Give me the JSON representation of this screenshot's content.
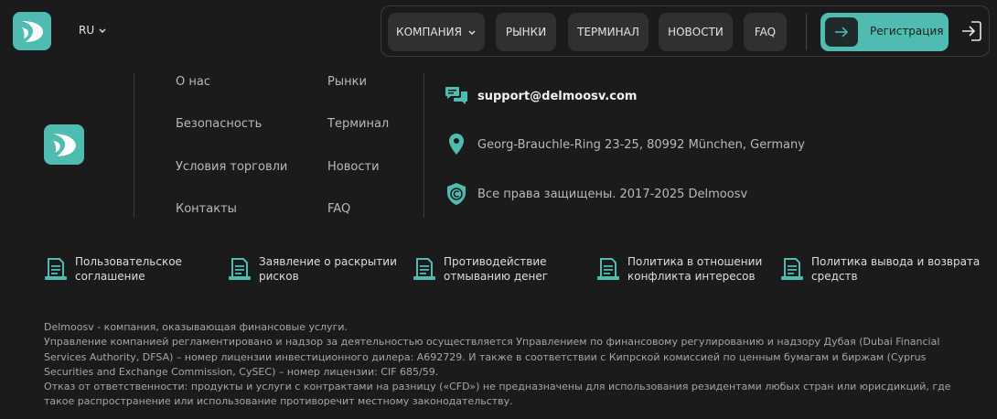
{
  "header": {
    "language": "RU",
    "nav": [
      {
        "label": "КОМПАНИЯ",
        "has_dropdown": true
      },
      {
        "label": "РЫНКИ",
        "has_dropdown": false
      },
      {
        "label": "ТЕРМИНАЛ",
        "has_dropdown": false
      },
      {
        "label": "НОВОСТИ",
        "has_dropdown": false
      },
      {
        "label": "FAQ",
        "has_dropdown": false
      }
    ],
    "register_label": "Регистрация"
  },
  "footer": {
    "links_col1": [
      "О нас",
      "Безопасность",
      "Условия торговли",
      "Контакты"
    ],
    "links_col2": [
      "Рынки",
      "Терминал",
      "Новости",
      "FAQ"
    ],
    "contacts": {
      "email": "support@delmoosv.com",
      "address": "Georg-Brauchle-Ring 23-25, 80992 München, Germany",
      "copyright": "Все права защищены. 2017-2025 Delmoosv"
    },
    "documents": [
      {
        "line1": "Пользовательское",
        "line2": "соглашение"
      },
      {
        "line1": "Заявление о раскрытии",
        "line2": "рисков"
      },
      {
        "line1": "Противодействие",
        "line2": "отмыванию денег"
      },
      {
        "line1": "Политика в отношении",
        "line2": "конфликта интересов"
      },
      {
        "line1": "Политика вывода и возврата",
        "line2": "средств"
      }
    ],
    "legal": [
      "Delmoosv - компания, оказывающая финансовые услуги.",
      "Управление компанией регламентировано и надзор за деятельностью осуществляется Управлением по финансовому регулированию и надзору Дубая (Dubai Financial Services Authority, DFSA) – номер лицензии инвестиционного дилера: A692729. И также в соответствии с Кипрской комиссией по ценным бумагам и биржам (Cyprus Securities and Exchange Commission, CySEC) – номер лицензии: CIF 685/59.",
      "Отказ от ответственности: продукты и услуги с контрактами на разницу («CFD») не предназначены для использования резидентами любых стран или юрисдикций, где такое распространение или использование противоречит местному законодательству."
    ]
  },
  "colors": {
    "accent": "#4ebdb0",
    "background": "#1b1b1d",
    "nav_button": "#303033"
  },
  "icons": {
    "logo": "brand-logo-icon",
    "email": "chat-bubbles-icon",
    "address": "map-pin-icon",
    "copyright": "copyright-icon",
    "document": "document-icon",
    "login": "login-icon"
  }
}
